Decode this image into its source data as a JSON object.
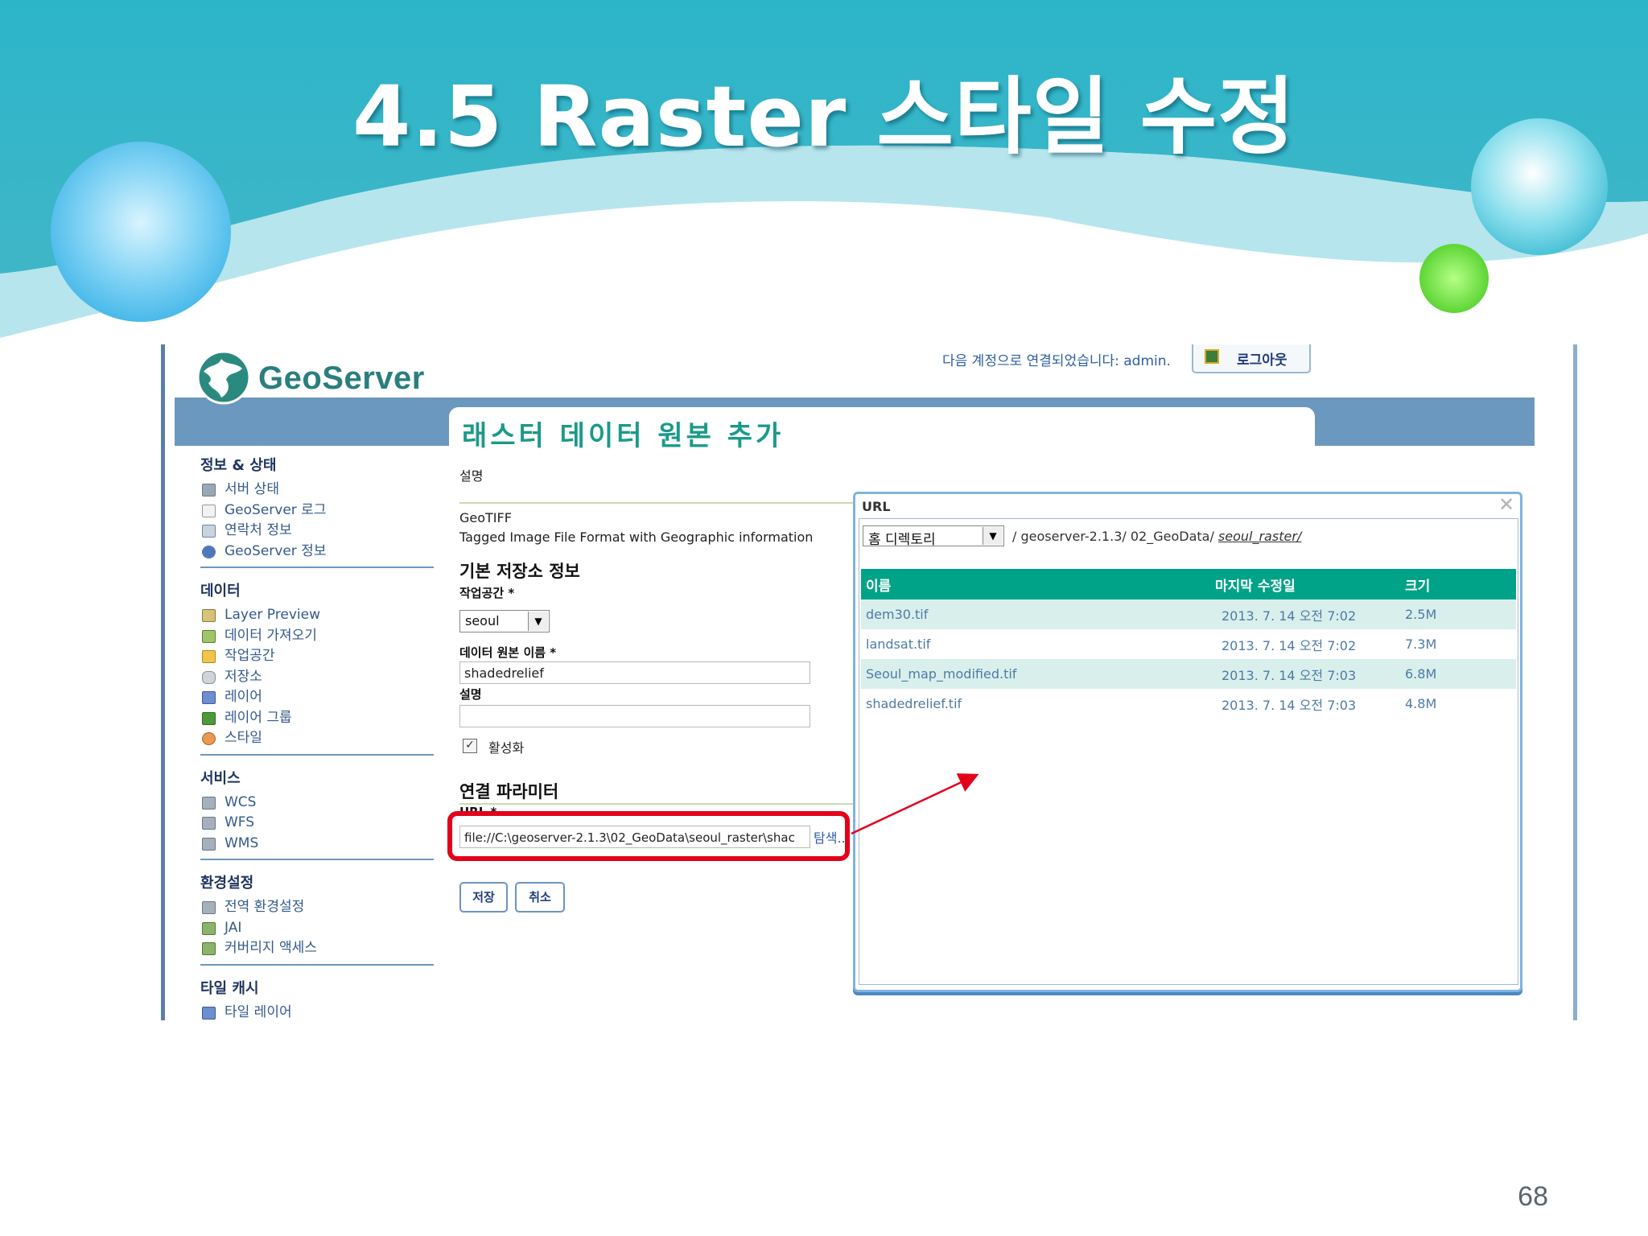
{
  "slide": {
    "title": "4.5 Raster 스타일 수정",
    "page_number": "68"
  },
  "geoserver": {
    "logo_text": "GeoServer",
    "logged_in_text": "다음 계정으로 연결되었습니다: admin.",
    "logout_label": "로그아웃"
  },
  "sidebar": {
    "sections": [
      {
        "title": "정보 & 상태",
        "items": [
          "서버 상태",
          "GeoServer 로그",
          "연락처 정보",
          "GeoServer 정보"
        ]
      },
      {
        "title": "데이터",
        "items": [
          "Layer Preview",
          "데이터 가져오기",
          "작업공간",
          "저장소",
          "레이어",
          "레이어 그룹",
          "스타일"
        ]
      },
      {
        "title": "서비스",
        "items": [
          "WCS",
          "WFS",
          "WMS"
        ]
      },
      {
        "title": "환경설정",
        "items": [
          "전역 환경설정",
          "JAI",
          "커버리지 액세스"
        ]
      },
      {
        "title": "타일 캐시",
        "items": [
          "타일 레이어"
        ]
      }
    ]
  },
  "main": {
    "title": "래스터 데이터 원본 추가",
    "description_label": "설명",
    "format_name": "GeoTIFF",
    "format_desc": "Tagged Image File Format with Geographic information",
    "basic_info_heading": "기본 저장소 정보",
    "workspace_label": "작업공간 *",
    "workspace_value": "seoul",
    "datasource_label": "데이터 원본 이름 *",
    "datasource_value": "shadedrelief",
    "desc_label": "설명",
    "desc_value": "",
    "enabled_label": "활성화",
    "enabled": true,
    "conn_heading": "연결 파라미터",
    "url_label": "URL *",
    "url_value": "file://C:\\geoserver-2.1.3\\02_GeoData\\seoul_raster\\shac",
    "browse_label": "탐색...",
    "save_label": "저장",
    "cancel_label": "취소"
  },
  "dialog": {
    "title": "URL",
    "dir_select_value": "홈 디렉토리",
    "path_prefix": "/ geoserver-2.1.3/ 02_GeoData/ ",
    "path_last": "seoul_raster/",
    "columns": [
      "이름",
      "마지막 수정일",
      "크기"
    ],
    "files": [
      {
        "name": "dem30.tif",
        "modified": "2013. 7. 14 오전 7:02",
        "size": "2.5M"
      },
      {
        "name": "landsat.tif",
        "modified": "2013. 7. 14 오전 7:02",
        "size": "7.3M"
      },
      {
        "name": "Seoul_map_modified.tif",
        "modified": "2013. 7. 14 오전 7:03",
        "size": "6.8M"
      },
      {
        "name": "shadedrelief.tif",
        "modified": "2013. 7. 14 오전 7:03",
        "size": "4.8M"
      }
    ]
  },
  "colors": {
    "accent_teal": "#00a388",
    "highlight_red": "#e3001b",
    "header_bar": "#6b98be"
  }
}
